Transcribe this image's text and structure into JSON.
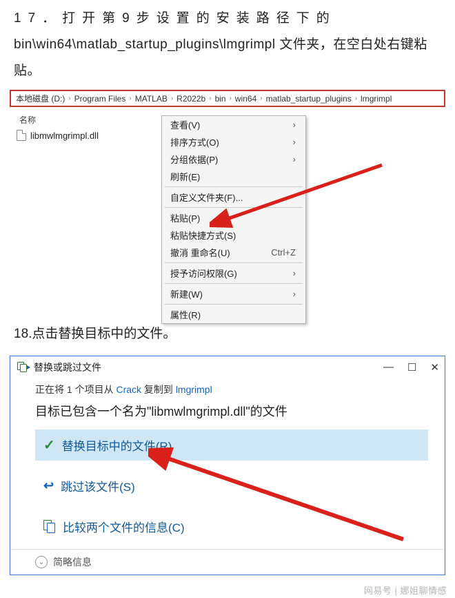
{
  "step17": {
    "spread_part": "17．打开第9步设置的安装路径下的",
    "line2": "bin\\win64\\matlab_startup_plugins\\lmgrimpl 文件夹，在空白处右键粘贴。"
  },
  "breadcrumb": [
    "本地磁盘 (D:)",
    "Program Files",
    "MATLAB",
    "R2022b",
    "bin",
    "win64",
    "matlab_startup_plugins",
    "lmgrimpl"
  ],
  "explorer": {
    "col_header": "名称",
    "file": "libmwlmgrimpl.dll"
  },
  "context_menu": [
    {
      "label": "查看(V)",
      "sub": "›",
      "sep": false
    },
    {
      "label": "排序方式(O)",
      "sub": "›",
      "sep": false
    },
    {
      "label": "分组依据(P)",
      "sub": "›",
      "sep": false
    },
    {
      "label": "刷新(E)",
      "sub": "",
      "sep": false
    },
    {
      "sep": true
    },
    {
      "label": "自定义文件夹(F)...",
      "sub": "",
      "sep": false
    },
    {
      "sep": true
    },
    {
      "label": "粘贴(P)",
      "sub": "",
      "sep": false
    },
    {
      "label": "粘贴快捷方式(S)",
      "sub": "",
      "sep": false
    },
    {
      "label": "撤消 重命名(U)",
      "sub": "Ctrl+Z",
      "sep": false
    },
    {
      "sep": true
    },
    {
      "label": "授予访问权限(G)",
      "sub": "›",
      "sep": false
    },
    {
      "sep": true
    },
    {
      "label": "新建(W)",
      "sub": "›",
      "sep": false
    },
    {
      "sep": true
    },
    {
      "label": "属性(R)",
      "sub": "",
      "sep": false
    }
  ],
  "step18": "18.点击替换目标中的文件。",
  "dialog": {
    "title": "替换或跳过文件",
    "copying_prefix": "正在将 1 个项目从 ",
    "copying_src": "Crack",
    "copying_mid": " 复制到 ",
    "copying_dst": "lmgrimpl",
    "already_prefix": "目标已包含一个名为\"",
    "already_file": "libmwlmgrimpl.dll",
    "already_suffix": "\"的文件",
    "opt_replace": "替换目标中的文件(R)",
    "opt_skip": "跳过该文件(S)",
    "opt_compare": "比较两个文件的信息(C)",
    "footer": "简略信息"
  },
  "watermark": "网易号 | 娜姐聊情感"
}
